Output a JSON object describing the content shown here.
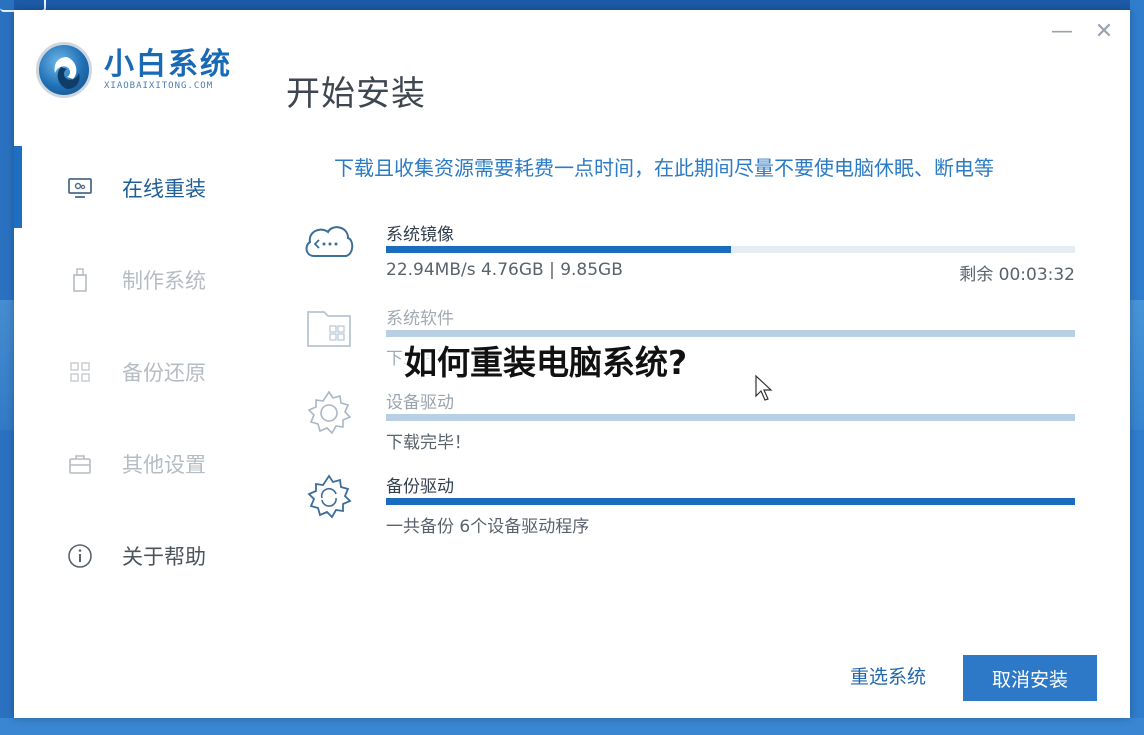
{
  "app": {
    "logo_name": "小白系统",
    "logo_sub": "XIAOBAIXITONG.COM",
    "page_title": "开始安装",
    "minimize_glyph": "—",
    "close_glyph": "✕"
  },
  "sidebar": {
    "items": [
      {
        "label": "在线重装",
        "icon": "monitor-icon",
        "state": "active"
      },
      {
        "label": "制作系统",
        "icon": "usb-icon",
        "state": "dim"
      },
      {
        "label": "备份还原",
        "icon": "grid-icon",
        "state": "dim"
      },
      {
        "label": "其他设置",
        "icon": "toolbox-icon",
        "state": "dim"
      },
      {
        "label": "关于帮助",
        "icon": "info-icon",
        "state": "normal"
      }
    ]
  },
  "main": {
    "notice": "下载且收集资源需要耗费一点时间，在此期间尽量不要使电脑休眠、断电等",
    "tasks": [
      {
        "name": "系统镜像",
        "info": "22.94MB/s 4.76GB | 9.85GB",
        "remaining": "剩余 00:03:32",
        "progress": 0.5,
        "icon": "cloud-icon"
      },
      {
        "name": "系统软件",
        "info": "下载完毕！",
        "progress": 0,
        "icon": "folder-icon"
      },
      {
        "name": "设备驱动",
        "info": "下载完毕！",
        "progress": 0,
        "icon": "gear-icon"
      },
      {
        "name": "备份驱动",
        "info": "一共备份 6个设备驱动程序",
        "progress": 1.0,
        "icon": "gear-icon"
      }
    ]
  },
  "overlay": {
    "caption": "如何重装电脑系统?"
  },
  "footer": {
    "reselect_label": "重选系统",
    "cancel_label": "取消安装"
  },
  "colors": {
    "accent": "#1a6cbf",
    "notice": "#2c7bc6",
    "cancel_button": "#2d79c8"
  }
}
